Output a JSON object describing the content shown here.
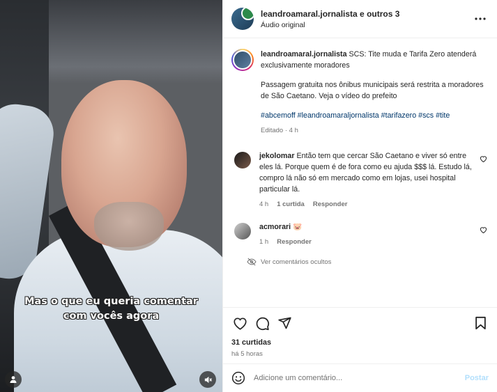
{
  "video": {
    "caption_line1": "Mas o que eu queria comentar",
    "caption_line2": "com vocês agora"
  },
  "header": {
    "username": "leandroamaral.jornalista e outros 3",
    "audio": "Áudio original"
  },
  "post": {
    "author": "leandroamaral.jornalista",
    "title": "SCS: Tite muda e Tarifa Zero atenderá exclusivamente moradores",
    "body": "Passagem gratuita nos ônibus municipais será restrita a moradores de São Caetano. Veja o vídeo do prefeito",
    "tags": "#abcemoff #leandroamaraljornalista #tarifazero #scs #tite",
    "edited": "Editado · 4 h"
  },
  "comments": [
    {
      "user": "jekolomar",
      "text": "Então tem que cercar São Caetano e viver só entre eles lá. Porque quem é de fora como eu ajuda $$$ lá. Estudo lá, compro lá não só em mercado como em lojas, usei hospital particular lá.",
      "time": "4 h",
      "likes": "1 curtida",
      "reply": "Responder"
    },
    {
      "user": "acmorari",
      "text": "🐷",
      "time": "1 h",
      "reply": "Responder"
    }
  ],
  "hidden_comments": "Ver comentários ocultos",
  "actions": {
    "likes": "31 curtidas",
    "time": "há 5 horas"
  },
  "add_comment": {
    "placeholder": "Adicione um comentário...",
    "post": "Postar"
  },
  "colors": {
    "link": "#00376b",
    "muted": "#737373",
    "post_button": "#b2dffc"
  }
}
